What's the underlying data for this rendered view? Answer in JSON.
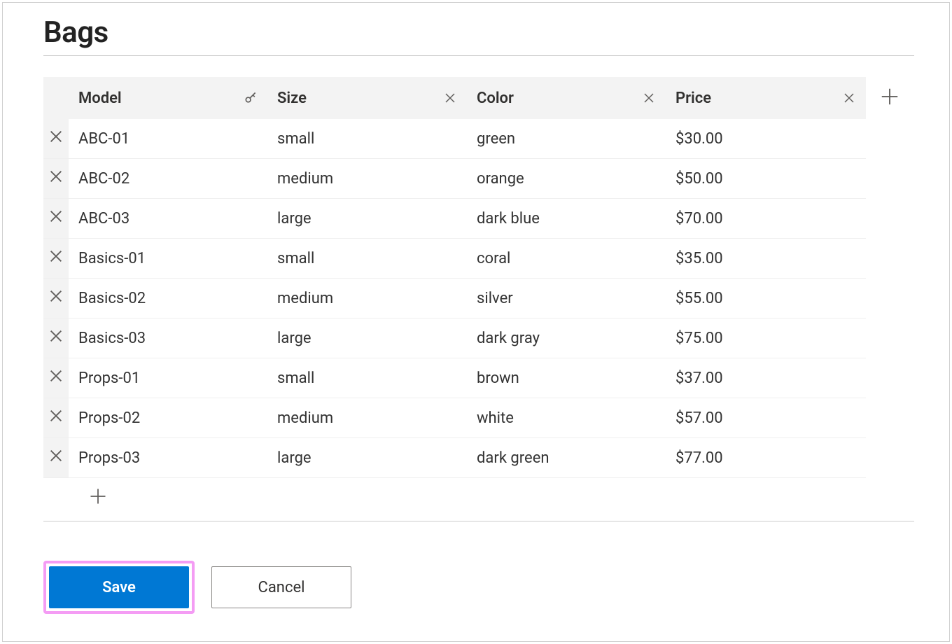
{
  "page": {
    "title": "Bags"
  },
  "columns": {
    "model": {
      "label": "Model",
      "headerAction": "key"
    },
    "size": {
      "label": "Size",
      "headerAction": "remove"
    },
    "color": {
      "label": "Color",
      "headerAction": "remove"
    },
    "price": {
      "label": "Price",
      "headerAction": "remove"
    }
  },
  "rows": [
    {
      "model": "ABC-01",
      "size": "small",
      "color": "green",
      "price": "$30.00"
    },
    {
      "model": "ABC-02",
      "size": "medium",
      "color": "orange",
      "price": "$50.00"
    },
    {
      "model": "ABC-03",
      "size": "large",
      "color": "dark blue",
      "price": "$70.00"
    },
    {
      "model": "Basics-01",
      "size": "small",
      "color": "coral",
      "price": "$35.00"
    },
    {
      "model": "Basics-02",
      "size": "medium",
      "color": "silver",
      "price": "$55.00"
    },
    {
      "model": "Basics-03",
      "size": "large",
      "color": "dark gray",
      "price": "$75.00"
    },
    {
      "model": "Props-01",
      "size": "small",
      "color": "brown",
      "price": "$37.00"
    },
    {
      "model": "Props-02",
      "size": "medium",
      "color": "white",
      "price": "$57.00"
    },
    {
      "model": "Props-03",
      "size": "large",
      "color": "dark green",
      "price": "$77.00"
    }
  ],
  "buttons": {
    "save": "Save",
    "cancel": "Cancel"
  }
}
